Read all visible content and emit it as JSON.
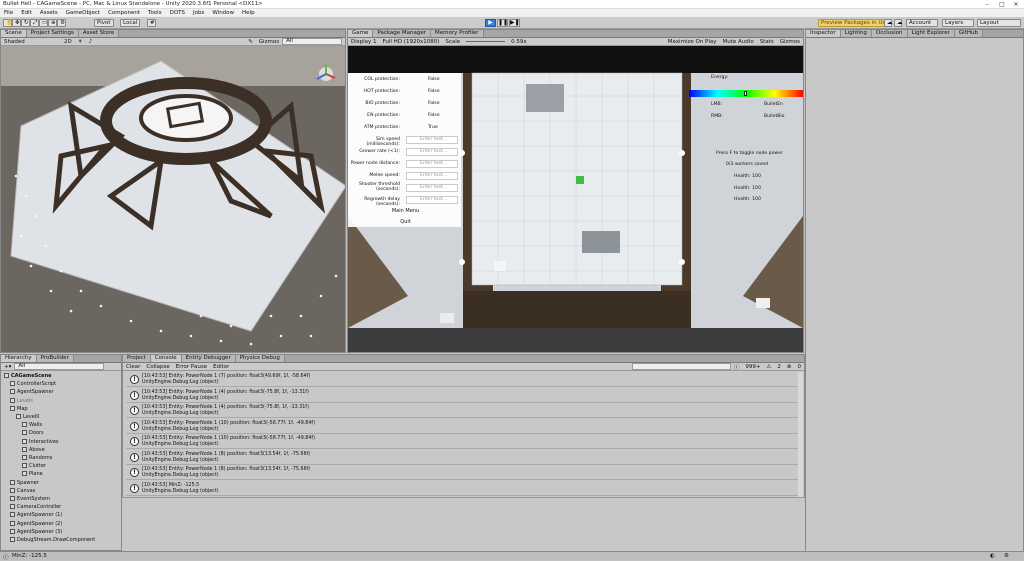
{
  "window": {
    "title": "Bullet Hell - CAGameScene - PC, Mac & Linux Standalone - Unity 2020.3.6f1 Personal <DX11>"
  },
  "menu": [
    "File",
    "Edit",
    "Assets",
    "GameObject",
    "Component",
    "Tools",
    "DOTS",
    "Jobs",
    "Window",
    "Help"
  ],
  "toolbar": {
    "pivot": "Pivot",
    "local": "Local",
    "preview_packages": "Preview Packages in Use",
    "account": "Account",
    "layers": "Layers",
    "layout": "Layout"
  },
  "scene": {
    "tabs": [
      "Scene",
      "Project Settings",
      "Asset Store"
    ],
    "shading": "Shaded",
    "mode_2d": "2D",
    "gizmos": "Gizmos",
    "search": "All"
  },
  "game": {
    "tabs": [
      "Game",
      "Package Manager",
      "Memory Profiler"
    ],
    "display": "Display 1",
    "resolution": "Full HD (1920x1080)",
    "scale_label": "Scale",
    "scale_value": "0.59x",
    "toggles": [
      "Maximize On Play",
      "Mute Audio",
      "Stats",
      "Gizmos"
    ],
    "protections": [
      {
        "label": "COL protection:",
        "value": "False"
      },
      {
        "label": "HOT protection:",
        "value": "False"
      },
      {
        "label": "BIO protection:",
        "value": "False"
      },
      {
        "label": "EN protection:",
        "value": "False"
      },
      {
        "label": "ATM protection:",
        "value": "True"
      }
    ],
    "fields": [
      {
        "label": "Sim speed (milliseconds):",
        "placeholder": "Enter text..."
      },
      {
        "label": "Grower rate (<1):",
        "placeholder": "Enter text..."
      },
      {
        "label": "Power node distance:",
        "placeholder": "Enter text..."
      },
      {
        "label": "Melee speed:",
        "placeholder": "Enter text..."
      },
      {
        "label": "Shooter threshold (seconds):",
        "placeholder": "Enter text..."
      },
      {
        "label": "Regrowth delay (seconds):",
        "placeholder": "Enter text..."
      }
    ],
    "main_menu": "Main Menu",
    "quit": "Quit",
    "hud": {
      "energy": "Energy:",
      "lmb": "LMB:",
      "lmb_val": "BulletEn",
      "rmb": "RMB:",
      "rmb_val": "BulletBio",
      "toggle_hint": "Press F to toggle node power",
      "workers": "0/3 workers saved",
      "health": [
        "Health: 100",
        "Health: 100",
        "Health: 100"
      ]
    },
    "energy_level": 0.5
  },
  "inspector": {
    "tabs": [
      "Inspector",
      "Lighting",
      "Occlusion",
      "Light Explorer",
      "GitHub"
    ]
  },
  "hierarchy": {
    "tabs": [
      "Hierarchy",
      "ProBuilder"
    ],
    "search": "All",
    "items": [
      {
        "label": "CAGameScene",
        "indent": 0,
        "bold": true
      },
      {
        "label": "ControllerScript",
        "indent": 1
      },
      {
        "label": "AgentSpawner",
        "indent": 1
      },
      {
        "label": "Levels",
        "indent": 1,
        "dim": true
      },
      {
        "label": "Map",
        "indent": 1
      },
      {
        "label": "Level0",
        "indent": 2
      },
      {
        "label": "Walls",
        "indent": 3
      },
      {
        "label": "Doors",
        "indent": 3
      },
      {
        "label": "Interactives",
        "indent": 3
      },
      {
        "label": "Above",
        "indent": 3
      },
      {
        "label": "Randoms",
        "indent": 3
      },
      {
        "label": "Clutter",
        "indent": 3
      },
      {
        "label": "Plane",
        "indent": 3
      },
      {
        "label": "Spawner",
        "indent": 1
      },
      {
        "label": "Canvas",
        "indent": 1
      },
      {
        "label": "EventSystem",
        "indent": 1
      },
      {
        "label": "CameraController",
        "indent": 1
      },
      {
        "label": "AgentSpawner (1)",
        "indent": 1
      },
      {
        "label": "AgentSpawner (2)",
        "indent": 1
      },
      {
        "label": "AgentSpawner (3)",
        "indent": 1
      },
      {
        "label": "DebugStream.DrawComponent",
        "indent": 1
      }
    ]
  },
  "console": {
    "tabs": [
      "Project",
      "Console",
      "Entity Debugger",
      "Physics Debug"
    ],
    "buttons": [
      "Clear",
      "Collapse",
      "Error Pause",
      "Editor"
    ],
    "counts": {
      "info": "999+",
      "warn": "2",
      "err": "0"
    },
    "logs": [
      {
        "l1": "[10:43:53] Entity: PowerNode 1 (7) position: float3(49.69f, 1f, -58.64f)",
        "l2": "UnityEngine.Debug:Log (object)"
      },
      {
        "l1": "[10:43:53] Entity: PowerNode 1 (4) position: float3(-75.8f, 1f, -13.31f)",
        "l2": "UnityEngine.Debug:Log (object)"
      },
      {
        "l1": "[10:43:53] Entity: PowerNode 1 (4) position: float3(-75.8f, 1f, -13.31f)",
        "l2": "UnityEngine.Debug:Log (object)"
      },
      {
        "l1": "[10:43:53] Entity: PowerNode 1 (10) position: float3(-58.77f, 1f, -49.84f)",
        "l2": "UnityEngine.Debug:Log (object)"
      },
      {
        "l1": "[10:43:53] Entity: PowerNode 1 (10) position: float3(-58.77f, 1f, -49.84f)",
        "l2": "UnityEngine.Debug:Log (object)"
      },
      {
        "l1": "[10:43:53] Entity: PowerNode 1 (8) position: float3(13.54f, 1f, -75.66f)",
        "l2": "UnityEngine.Debug:Log (object)"
      },
      {
        "l1": "[10:43:53] Entity: PowerNode 1 (8) position: float3(13.54f, 1f, -75.66f)",
        "l2": "UnityEngine.Debug:Log (object)"
      },
      {
        "l1": "[10:43:53] MinZ: -125.5",
        "l2": "UnityEngine.Debug:Log (object)"
      }
    ]
  },
  "status": {
    "text": "MinZ: -125.5"
  }
}
